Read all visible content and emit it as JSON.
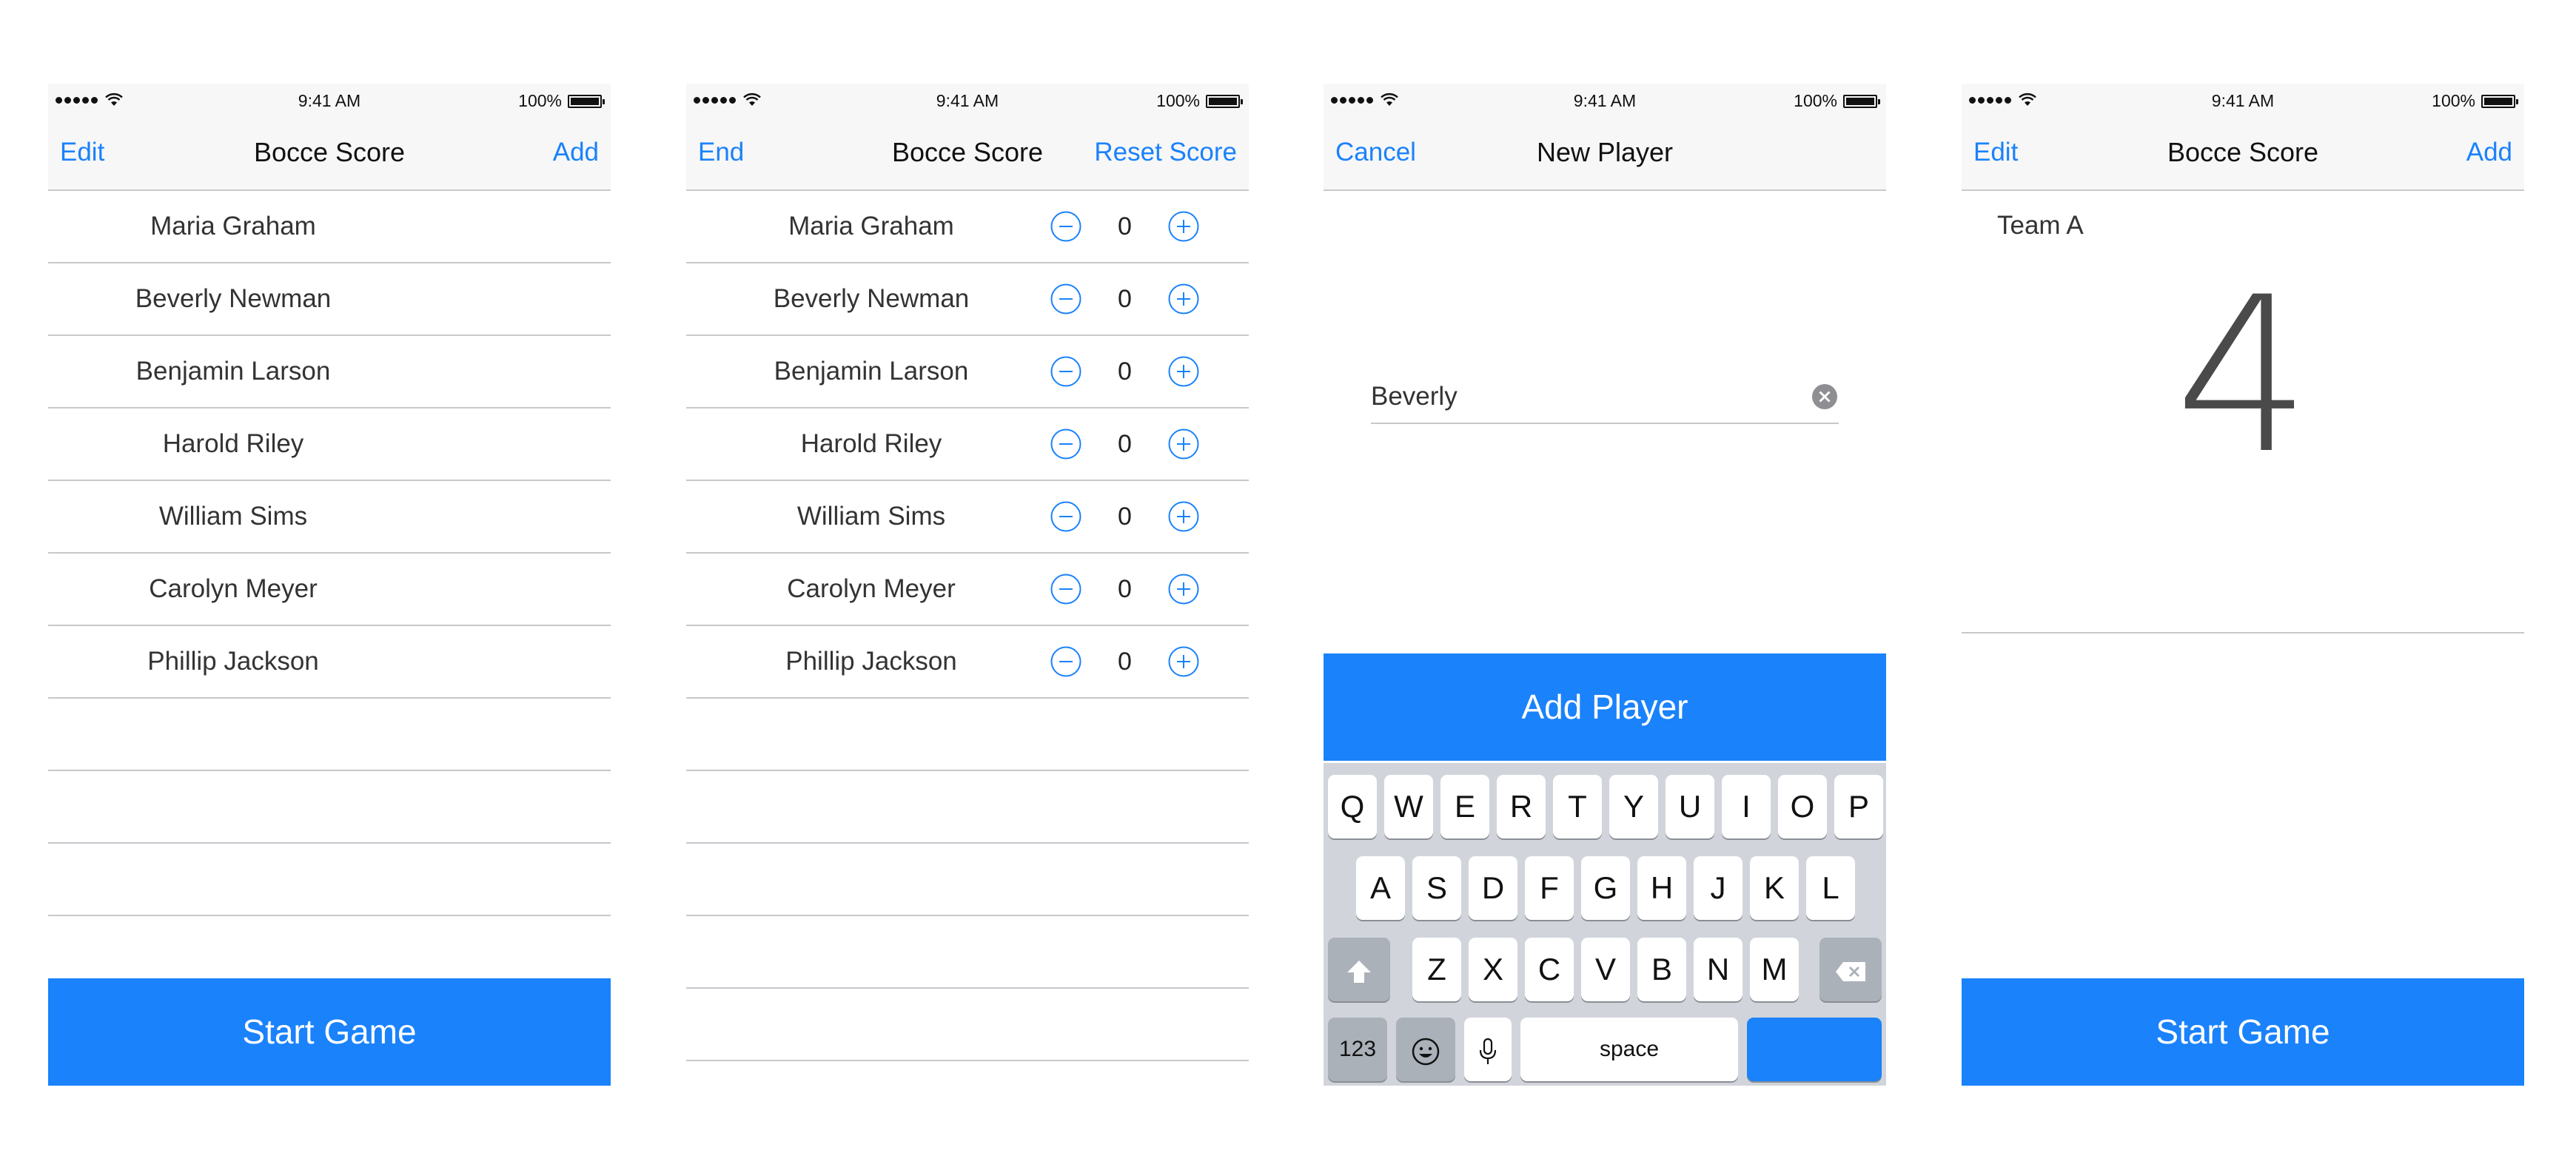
{
  "status_bar": {
    "time": "9:41 AM",
    "battery": "100%"
  },
  "players": [
    "Maria Graham",
    "Beverly Newman",
    "Benjamin Larson",
    "Harold Riley",
    "William Sims",
    "Carolyn Meyer",
    "Phillip Jackson"
  ],
  "screen1": {
    "nav_left": "Edit",
    "title": "Bocce Score",
    "nav_right": "Add",
    "start_button": "Start Game"
  },
  "screen2": {
    "nav_left": "End",
    "title": "Bocce Score",
    "nav_right": "Reset Score",
    "scores": [
      "0",
      "0",
      "0",
      "0",
      "0",
      "0",
      "0"
    ],
    "minus_icon": "minus-circle-icon",
    "plus_icon": "plus-circle-icon"
  },
  "screen3": {
    "nav_left": "Cancel",
    "title": "New Player",
    "name_value": "Beverly",
    "add_button": "Add Player",
    "keyboard": {
      "row1": [
        "Q",
        "W",
        "E",
        "R",
        "T",
        "Y",
        "U",
        "I",
        "O",
        "P"
      ],
      "row2": [
        "A",
        "S",
        "D",
        "F",
        "G",
        "H",
        "J",
        "K",
        "L"
      ],
      "row3": [
        "Z",
        "X",
        "C",
        "V",
        "B",
        "N",
        "M"
      ],
      "numbers_key": "123",
      "space_key": "space"
    }
  },
  "screen4": {
    "nav_left": "Edit",
    "title": "Bocce Score",
    "nav_right": "Add",
    "team_label": "Team A",
    "team_score": "4",
    "start_button": "Start Game"
  },
  "colors": {
    "accent": "#1a82fb",
    "separator": "#c8c7cc",
    "keyboard_bg": "#d1d5db"
  }
}
